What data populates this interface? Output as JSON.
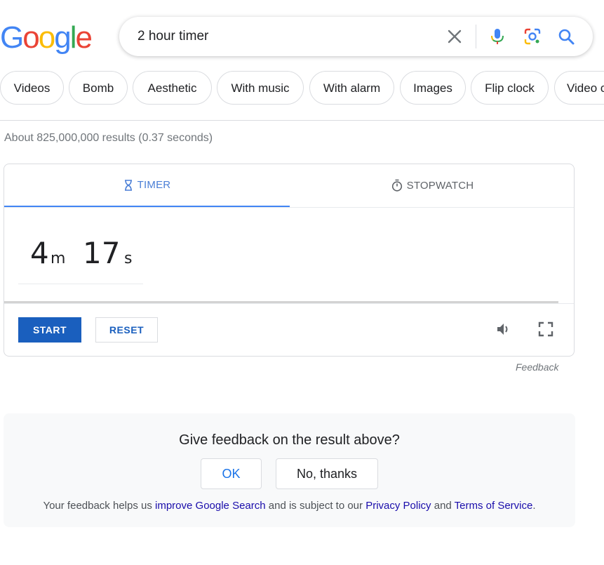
{
  "logo": {
    "letters": [
      "G",
      "o",
      "o",
      "g",
      "l",
      "e"
    ],
    "colors": [
      "#4285f4",
      "#ea4335",
      "#fbbc05",
      "#4285f4",
      "#34a853",
      "#ea4335"
    ]
  },
  "search": {
    "value": "2 hour timer"
  },
  "chips": [
    "Videos",
    "Bomb",
    "Aesthetic",
    "With music",
    "With alarm",
    "Images",
    "Flip clock",
    "Video c"
  ],
  "results_stats": "About 825,000,000 results (0.37 seconds)",
  "timer": {
    "tabs": {
      "timer": "TIMER",
      "stopwatch": "STOPWATCH"
    },
    "minutes": "4",
    "minutes_unit": "m",
    "seconds": "17",
    "seconds_unit": "s",
    "progress_fraction": 0.97,
    "start_label": "START",
    "reset_label": "RESET",
    "accent_color": "#1a5fbe"
  },
  "feedback_link": "Feedback",
  "feedback_panel": {
    "question": "Give feedback on the result above?",
    "ok_label": "OK",
    "no_label": "No, thanks",
    "note_prefix": "Your feedback helps us ",
    "improve_link": "improve Google Search",
    "note_middle": " and is subject to our ",
    "privacy_link": "Privacy Policy",
    "note_and": " and ",
    "terms_link": "Terms of Service",
    "note_end": "."
  },
  "icons": [
    "close-icon",
    "microphone-icon",
    "lens-camera-icon",
    "search-icon",
    "hourglass-icon",
    "stopwatch-icon",
    "volume-icon",
    "fullscreen-icon"
  ]
}
